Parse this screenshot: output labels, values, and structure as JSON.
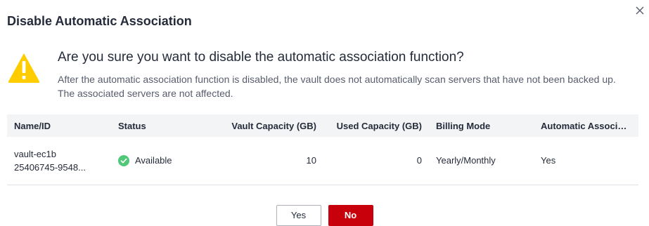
{
  "dialog": {
    "title": "Disable Automatic Association",
    "close_icon": "close-icon",
    "question": "Are you sure you want to disable the automatic association function?",
    "description": "After the automatic association function is disabled, the vault does not automatically scan servers that have not been backed up. The associated servers are not affected.",
    "warning_icon": "warning-triangle-icon",
    "warning_color": "#ffcc00"
  },
  "table": {
    "columns": [
      "Name/ID",
      "Status",
      "Vault Capacity (GB)",
      "Used Capacity (GB)",
      "Billing Mode",
      "Automatic Associati..."
    ],
    "rows": [
      {
        "name": "vault-ec1b",
        "id": "25406745-9548...",
        "status": "Available",
        "status_icon": "check-circle-icon",
        "status_color": "#50c878",
        "vault_capacity": "10",
        "used_capacity": "0",
        "billing_mode": "Yearly/Monthly",
        "automatic_association": "Yes"
      }
    ]
  },
  "footer": {
    "yes_label": "Yes",
    "no_label": "No",
    "primary_color": "#c7000b"
  }
}
